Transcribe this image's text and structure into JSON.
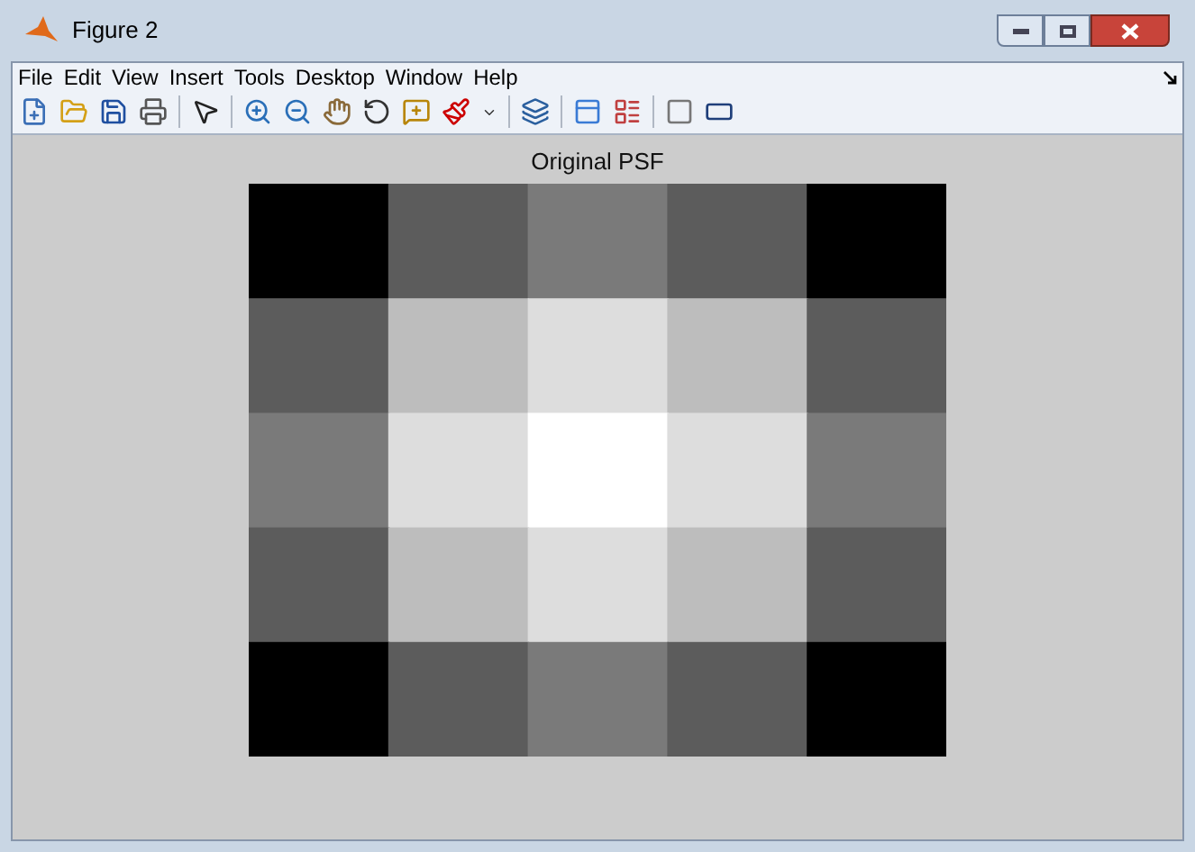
{
  "window": {
    "title": "Figure 2"
  },
  "menu": [
    "File",
    "Edit",
    "View",
    "Insert",
    "Tools",
    "Desktop",
    "Window",
    "Help"
  ],
  "axes": {
    "title": "Original PSF"
  }
}
